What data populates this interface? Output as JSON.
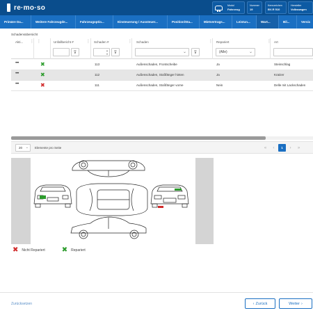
{
  "app": {
    "logo_text": "re·mo·so"
  },
  "header": {
    "car_label": "Modul",
    "car_value": "Fahrzeug",
    "nummer_label": "Nummer",
    "nummer_value": "19",
    "kennzeichen_label": "Kennzeichen",
    "kennzeichen_value": "BV-R 510",
    "hersteller_label": "Hersteller",
    "hersteller_value": "Volkswagen"
  },
  "tabs": [
    {
      "label": "Primäre Da..."
    },
    {
      "label": "Weitere Fahrzeugde..."
    },
    {
      "label": "Fahrzeugoptio..."
    },
    {
      "label": "Einsteuerung / Aussteuer..."
    },
    {
      "label": "Position/Sta..."
    },
    {
      "label": "Mietvertrags..."
    },
    {
      "label": "Leistun..."
    },
    {
      "label": "Wart..."
    },
    {
      "label": "Bil..."
    },
    {
      "label": "Versic"
    }
  ],
  "section_title": "Schadensübersicht",
  "grid": {
    "columns": {
      "aktion": "Akti...",
      "unfallbericht": "Unfallbericht #",
      "schaden_nr": "Schaden #",
      "schaden": "Schaden",
      "repariert": "Repariert",
      "art": "Art"
    },
    "repariert_filter": "(Alle)",
    "rows": [
      {
        "more": "•••",
        "mark": "✖",
        "mark_color": "green",
        "schaden_nr": "113",
        "schaden": "Außenschaden, Frontscheibe",
        "repariert": "Ja",
        "art": "Steinschlag"
      },
      {
        "more": "•••",
        "mark": "✖",
        "mark_color": "green",
        "schaden_nr": "112",
        "schaden": "Außenschaden, Stoßfänger hinten",
        "repariert": "Ja",
        "art": "Kratzer"
      },
      {
        "more": "•••",
        "mark": "✖",
        "mark_color": "red",
        "schaden_nr": "111",
        "schaden": "Außenschaden, Stoßfänger vorne",
        "repariert": "Nein",
        "art": "Delle mit Lackschaden"
      }
    ]
  },
  "pager": {
    "page_size": "20",
    "per_page_label": "Elemente pro Seite",
    "first": "«",
    "prev": "‹",
    "current": "1",
    "next": "›",
    "last": "»"
  },
  "legend": [
    {
      "mark": "✖",
      "color": "#d12b2b",
      "label": "Nicht Repariert"
    },
    {
      "mark": "✖",
      "color": "#2d9c2d",
      "label": "Repariert"
    }
  ],
  "footer": {
    "reset": "Zurücksetzen",
    "back_label": "Zurück",
    "back_icon": "‹",
    "next_label": "Weiter",
    "next_icon": "›"
  },
  "colors": {
    "header_bg": "#0a4d8c",
    "tab_bg": "#1a6fc2",
    "accent": "#1a6fc2",
    "repaired": "#2d9c2d",
    "not_repaired": "#d12b2b"
  }
}
